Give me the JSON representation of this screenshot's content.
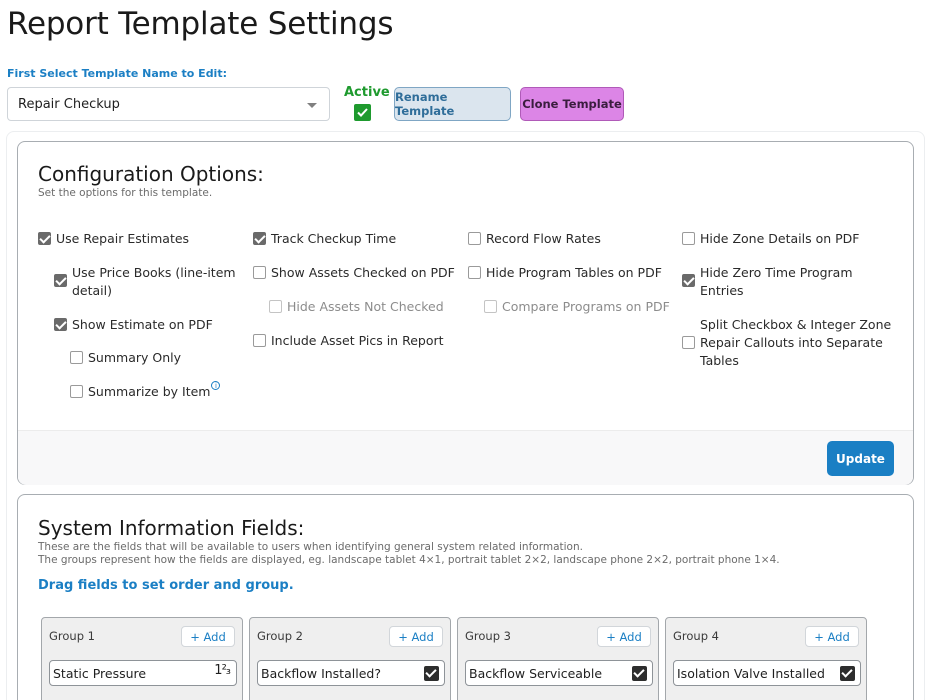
{
  "page": {
    "title": "Report Template Settings"
  },
  "template_picker": {
    "label": "First Select Template Name to Edit:",
    "selected": "Repair Checkup",
    "active_label": "Active",
    "active_checked": true,
    "rename_label": "Rename Template",
    "clone_label": "Clone Template"
  },
  "config": {
    "title": "Configuration Options:",
    "subtitle": "Set the options for this template.",
    "update_label": "Update",
    "options": [
      {
        "label": "Use Repair Estimates",
        "checked": true
      },
      {
        "label": "Use Price Books (line-item detail)",
        "checked": true
      },
      {
        "label": "Show Estimate on PDF",
        "checked": true
      },
      {
        "label": "Summary Only",
        "checked": false
      },
      {
        "label": "Summarize by Item",
        "checked": false,
        "info": "i"
      },
      {
        "label": "Track Checkup Time",
        "checked": true
      },
      {
        "label": "Show Assets Checked on PDF",
        "checked": false
      },
      {
        "label": "Hide Assets Not Checked",
        "checked": false,
        "disabled": true
      },
      {
        "label": "Include Asset Pics in Report",
        "checked": false
      },
      {
        "label": "Record Flow Rates",
        "checked": false
      },
      {
        "label": "Hide Program Tables on PDF",
        "checked": false
      },
      {
        "label": "Compare Programs on PDF",
        "checked": false,
        "disabled": true
      },
      {
        "label": "Hide Zone Details on PDF",
        "checked": false
      },
      {
        "label": "Hide Zero Time Program Entries",
        "checked": true
      },
      {
        "label": "Split Checkbox & Integer Zone Repair Callouts into Separate Tables",
        "checked": false
      }
    ]
  },
  "system_fields": {
    "title": "System Information Fields:",
    "desc1": "These are the fields that will be available to users when identifying general system related information.",
    "desc2": "The groups represent how the fields are displayed, eg. landscape tablet 4×1, portrait tablet 2×2, landscape phone 2×2, portrait phone 1×4.",
    "drag_hint": "Drag fields to set order and group.",
    "add_label": "+ Add",
    "groups": [
      {
        "name": "Group 1",
        "field": "Static Pressure",
        "type_glyph": "1²₃"
      },
      {
        "name": "Group 2",
        "field": "Backflow Installed?"
      },
      {
        "name": "Group 3",
        "field": "Backflow Serviceable"
      },
      {
        "name": "Group 4",
        "field": "Isolation Valve Installed"
      }
    ]
  },
  "colors": {
    "accent": "#1b7fc4",
    "active_green": "#1e9a2e",
    "clone_purple": "#dc85e6",
    "rename_bg": "#dbe5ee"
  }
}
